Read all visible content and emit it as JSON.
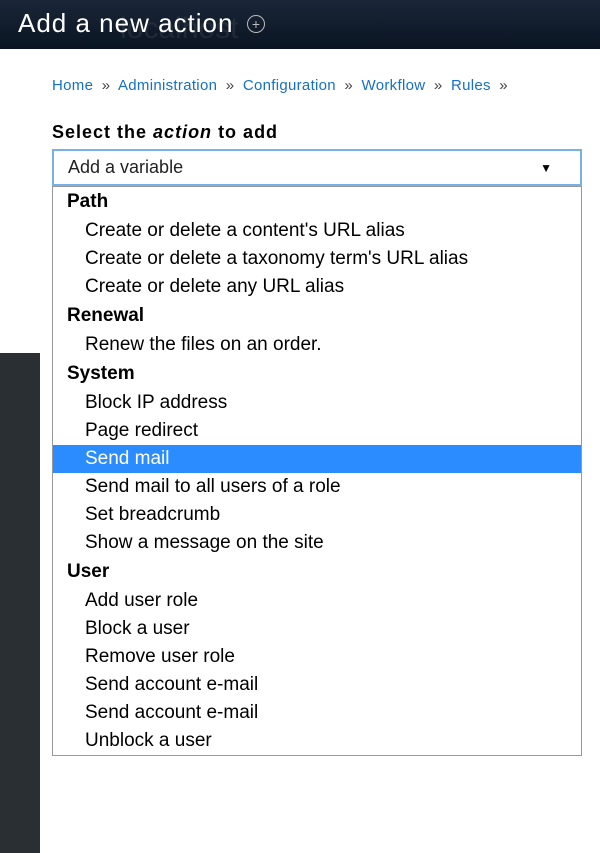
{
  "header": {
    "title": "Add a new action",
    "ghost": "localhost"
  },
  "breadcrumb": {
    "items": [
      {
        "label": "Home",
        "link": true
      },
      {
        "label": "Administration",
        "link": true
      },
      {
        "label": "Configuration",
        "link": true
      },
      {
        "label": "Workflow",
        "link": true
      },
      {
        "label": "Rules",
        "link": true
      }
    ],
    "sep": "»"
  },
  "field": {
    "label_prefix": "Select the ",
    "label_italic": "action",
    "label_suffix": " to add",
    "selected": "Add a variable"
  },
  "dropdown": {
    "groups": [
      {
        "label": "Path",
        "options": [
          "Create or delete a content's URL alias",
          "Create or delete a taxonomy term's URL alias",
          "Create or delete any URL alias"
        ]
      },
      {
        "label": "Renewal",
        "options": [
          "Renew the files on an order."
        ]
      },
      {
        "label": "System",
        "options": [
          "Block IP address",
          "Page redirect",
          "Send mail",
          "Send mail to all users of a role",
          "Set breadcrumb",
          "Show a message on the site"
        ]
      },
      {
        "label": "User",
        "options": [
          "Add user role",
          "Block a user",
          "Remove user role",
          "Send account e-mail",
          "Send account e-mail",
          "Unblock a user"
        ]
      }
    ],
    "highlighted": "Send mail"
  }
}
